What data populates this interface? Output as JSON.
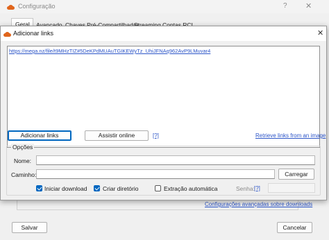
{
  "config": {
    "title": "Configuração",
    "help_glyph": "?",
    "close_glyph": "✕",
    "tabs": [
      {
        "label": "Geral"
      },
      {
        "label": "Avançado"
      },
      {
        "label": "Chaves Pré-Compartilhadas"
      },
      {
        "label": "Streaming"
      },
      {
        "label": "Contas RCL"
      }
    ],
    "bottom_link": "Configurações avançadas sobre downloads",
    "save_label": "Salvar",
    "cancel_label": "Cancelar"
  },
  "dialog": {
    "title": "Adicionar links",
    "close_glyph": "✕",
    "links_text": "https://mega.nz/file/t9MHzTIZ#5DeKPdMUAuTGIKEWyTz_UhiJFNAq962AvP9LMuvar4",
    "add_links_label": "Adicionar links",
    "watch_online_label": "Assistir online",
    "help_link": "[?]",
    "retrieve_link": "Retrieve links from an image",
    "options": {
      "title": "Opções",
      "name_label": "Nome:",
      "name_value": "",
      "path_label": "Caminho:",
      "path_value": "",
      "load_label": "Carregar",
      "start_download_label": "Iniciar download",
      "start_download_checked": true,
      "create_dir_label": "Criar diretório",
      "create_dir_checked": true,
      "auto_extract_label": "Extração automática",
      "auto_extract_checked": false,
      "password_label": "Senha:",
      "password_help": "[?]"
    }
  },
  "colors": {
    "accent": "#0067c0",
    "link": "#2c55c8",
    "brand": "#e0651c"
  }
}
